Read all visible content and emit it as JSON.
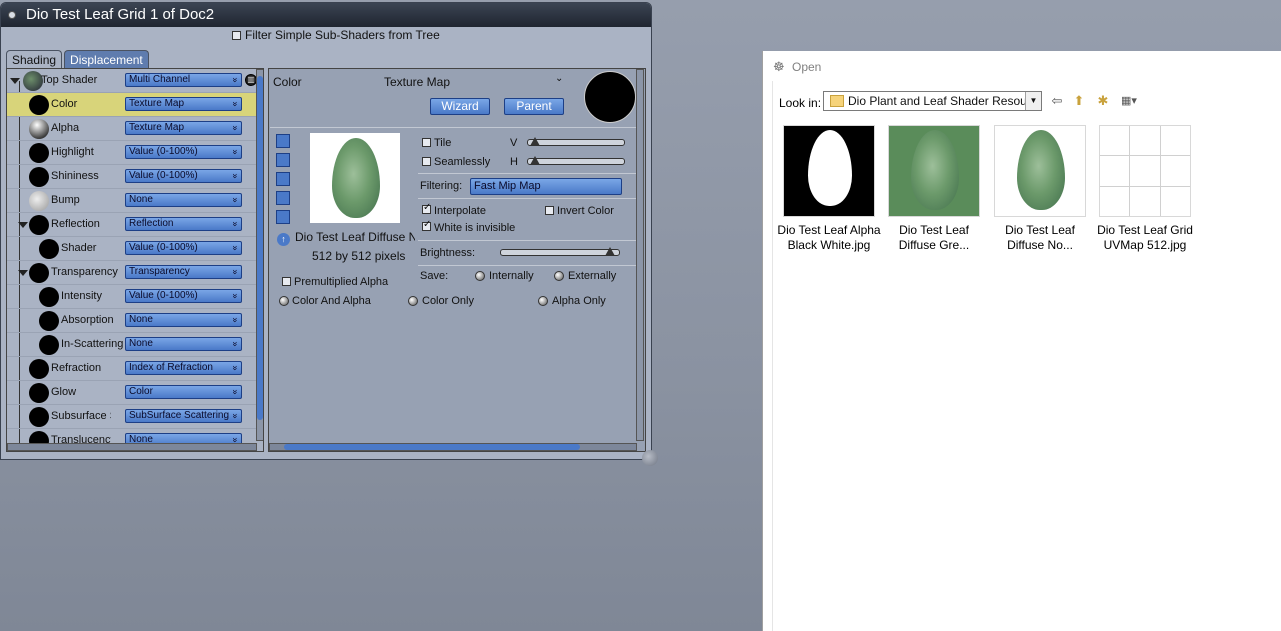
{
  "poser_window": {
    "title": "Dio Test Leaf Grid 1 of Doc2",
    "filter_label": "Filter Simple Sub-Shaders from Tree",
    "tabs": [
      "Shading",
      "Displacement"
    ]
  },
  "shader_tree": [
    {
      "label": "Top Shader",
      "value": "Multi Channel"
    },
    {
      "label": "Color",
      "value": "Texture Map"
    },
    {
      "label": "Alpha",
      "value": "Texture Map"
    },
    {
      "label": "Highlight",
      "value": "Value (0-100%)"
    },
    {
      "label": "Shininess",
      "value": "Value (0-100%)"
    },
    {
      "label": "Bump",
      "value": "None"
    },
    {
      "label": "Reflection",
      "value": "Reflection"
    },
    {
      "label": "Shader",
      "value": "Value (0-100%)"
    },
    {
      "label": "Transparency",
      "value": "Transparency"
    },
    {
      "label": "Intensity",
      "value": "Value (0-100%)"
    },
    {
      "label": "Absorption",
      "value": "None"
    },
    {
      "label": "In-Scattering",
      "value": "None"
    },
    {
      "label": "Refraction",
      "value": "Index of Refraction"
    },
    {
      "label": "Glow",
      "value": "Color"
    },
    {
      "label": "Subsurface S",
      "value": "SubSurface Scattering"
    },
    {
      "label": "Translucency",
      "value": "None"
    }
  ],
  "detail": {
    "channel": "Color",
    "type": "Texture Map",
    "wizard": "Wizard",
    "parent": "Parent",
    "image_name": "Dio Test Leaf Diffuse No",
    "image_size": "512 by 512 pixels",
    "tile": "Tile",
    "v": "V",
    "seamlessly": "Seamlessly",
    "h": "H",
    "filtering_label": "Filtering:",
    "filtering_value": "Fast Mip Map",
    "interpolate": "Interpolate",
    "invert_color": "Invert Color",
    "white_invisible": "White is invisible",
    "brightness": "Brightness:",
    "premultiplied": "Premultiplied Alpha",
    "save_label": "Save:",
    "internally": "Internally",
    "externally": "Externally",
    "color_and_alpha": "Color And Alpha",
    "color_only": "Color Only",
    "alpha_only": "Alpha Only"
  },
  "open_dialog": {
    "title": "Open",
    "look_in_label": "Look in:",
    "look_in_value": "Dio Plant and Leaf Shader Resources",
    "files": [
      {
        "line1": "Dio Test Leaf Alpha",
        "line2": "Black White.jpg"
      },
      {
        "line1": "Dio Test Leaf",
        "line2": "Diffuse Gre..."
      },
      {
        "line1": "Dio Test Leaf",
        "line2": "Diffuse No..."
      },
      {
        "line1": "Dio Test Leaf Grid",
        "line2": "UVMap 512.jpg"
      }
    ]
  }
}
